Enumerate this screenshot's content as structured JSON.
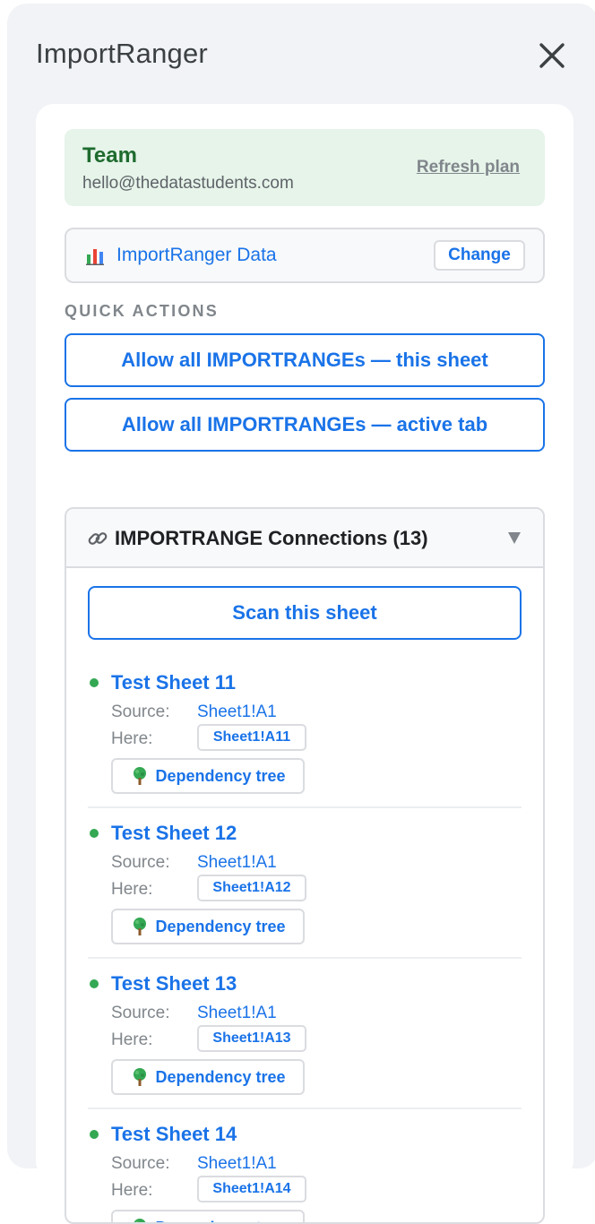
{
  "panel": {
    "title": "ImportRanger",
    "close_icon": "close-icon"
  },
  "plan": {
    "name": "Team",
    "email": "hello@thedatastudents.com",
    "refresh_label": "Refresh plan"
  },
  "data_source": {
    "icon": "bar-chart-icon",
    "name": "ImportRanger Data",
    "change_label": "Change"
  },
  "quick_actions": {
    "label": "QUICK ACTIONS",
    "allow_sheet_label": "Allow all IMPORTRANGEs — this sheet",
    "allow_tab_label": "Allow all IMPORTRANGEs — active tab"
  },
  "connections": {
    "icon": "link-icon",
    "title": "IMPORTRANGE Connections (13)",
    "caret": "chevron-down-icon",
    "scan_label": "Scan this sheet",
    "source_label": "Source:",
    "here_label": "Here:",
    "dependency_label": "Dependency tree",
    "status_color": "#34a853",
    "items": [
      {
        "name": "Test Sheet 11",
        "source": "Sheet1!A1",
        "here": "Sheet1!A11"
      },
      {
        "name": "Test Sheet 12",
        "source": "Sheet1!A1",
        "here": "Sheet1!A12"
      },
      {
        "name": "Test Sheet 13",
        "source": "Sheet1!A1",
        "here": "Sheet1!A13"
      },
      {
        "name": "Test Sheet 14",
        "source": "Sheet1!A1",
        "here": "Sheet1!A14"
      }
    ]
  },
  "colors": {
    "accent": "#1a73e8",
    "plan_bg": "#e6f4ea",
    "plan_text": "#1e6b2e"
  }
}
